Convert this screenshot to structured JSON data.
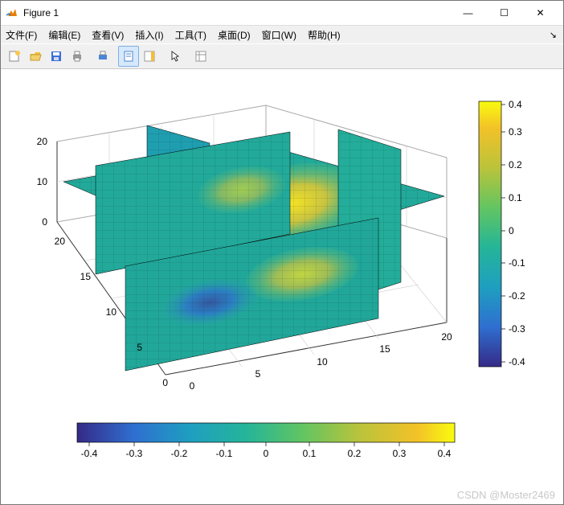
{
  "window": {
    "title": "Figure 1",
    "buttons": {
      "min": "—",
      "max": "☐",
      "close": "✕"
    }
  },
  "menu": {
    "items": [
      "文件(F)",
      "编辑(E)",
      "查看(V)",
      "插入(I)",
      "工具(T)",
      "桌面(D)",
      "窗口(W)",
      "帮助(H)"
    ]
  },
  "toolbar": {
    "names": [
      "new-figure-icon",
      "open-icon",
      "save-icon",
      "print-icon",
      "zoom-icon",
      "link-icon",
      "rotate-icon",
      "arrow-icon",
      "brush-icon"
    ]
  },
  "chart_data": {
    "type": "surface-slice-3d",
    "description": "MATLAB slice plot of a 3D scalar field showing orthogonal slice planes and a horizontal surface",
    "x_range": [
      0,
      20
    ],
    "y_range": [
      0,
      20
    ],
    "z_range": [
      0,
      20
    ],
    "x_ticks": [
      0,
      5,
      10,
      15,
      20
    ],
    "y_ticks": [
      0,
      5,
      10,
      15,
      20
    ],
    "z_ticks": [
      0,
      10,
      20
    ],
    "slice_planes": {
      "x": [
        5,
        15
      ],
      "y": [
        8,
        18
      ],
      "z": [
        10
      ]
    },
    "colormap": "parula",
    "color_range": [
      -0.45,
      0.45
    ],
    "colorbar_vertical": {
      "ticks": [
        -0.4,
        -0.3,
        -0.2,
        -0.1,
        0,
        0.1,
        0.2,
        0.3,
        0.4
      ]
    },
    "colorbar_horizontal": {
      "ticks": [
        -0.4,
        -0.3,
        -0.2,
        -0.1,
        0,
        0.1,
        0.2,
        0.3,
        0.4
      ]
    }
  },
  "axis_labels": {
    "z0": "0",
    "z10": "10",
    "z20": "20",
    "y0": "0",
    "y5": "5",
    "y10": "10",
    "y15": "15",
    "y20": "20",
    "x0": "0",
    "x5": "5",
    "x10": "10",
    "x15": "15",
    "x20": "20"
  },
  "cb_v": {
    "t0": "-0.4",
    "t1": "-0.3",
    "t2": "-0.2",
    "t3": "-0.1",
    "t4": "0",
    "t5": "0.1",
    "t6": "0.2",
    "t7": "0.3",
    "t8": "0.4"
  },
  "cb_h": {
    "t0": "-0.4",
    "t1": "-0.3",
    "t2": "-0.2",
    "t3": "-0.1",
    "t4": "0",
    "t5": "0.1",
    "t6": "0.2",
    "t7": "0.3",
    "t8": "0.4"
  },
  "watermark": "CSDN @Moster2469"
}
